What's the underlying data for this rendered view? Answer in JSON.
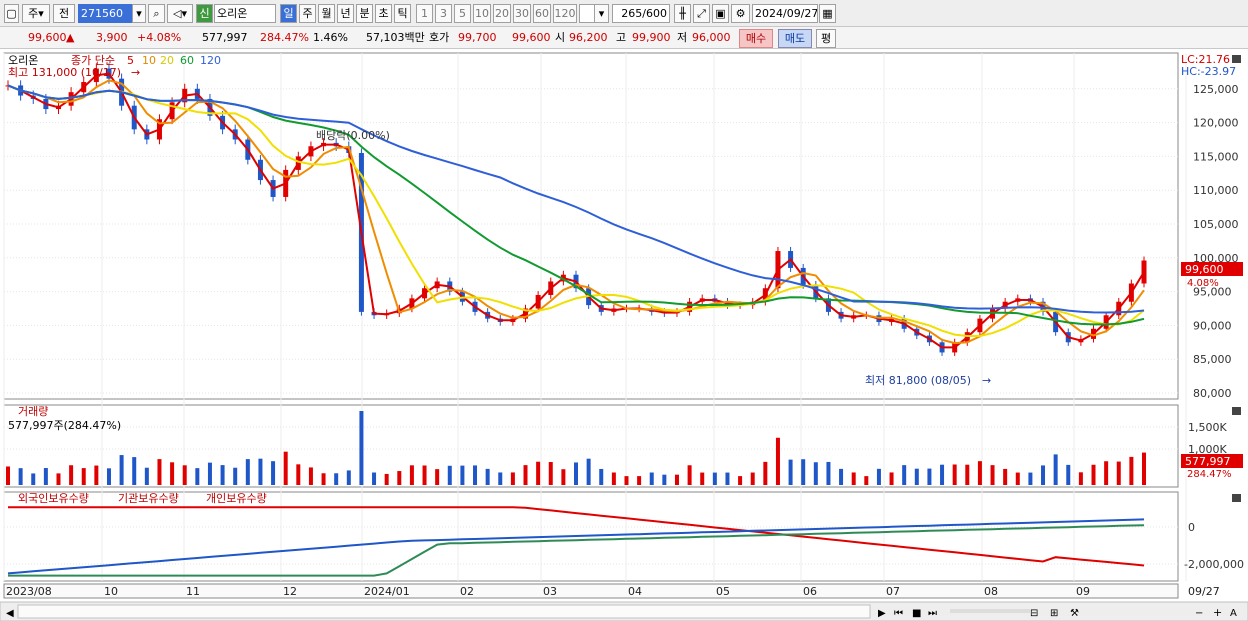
{
  "toolbar": {
    "market_label": "주",
    "prev_label": "전",
    "code": "271560",
    "badge": "신",
    "name": "오리온",
    "periods": [
      "일",
      "주",
      "월",
      "년",
      "분",
      "초",
      "틱"
    ],
    "intervals": [
      "1",
      "3",
      "5",
      "10",
      "20",
      "30",
      "60",
      "120"
    ],
    "count": "265",
    "count_max": "/600",
    "date": "2024/09/27"
  },
  "quote": {
    "price": "99,600",
    "arrow": "▲",
    "change": "3,900",
    "rate": "+4.08%",
    "volume": "577,997",
    "vol_ratio": "284.47%",
    "turnover": "1.46%",
    "amount": "57,103백만",
    "hoga_label": "호가",
    "ask": "99,700",
    "bid": "99,600",
    "open_label": "시",
    "open": "96,200",
    "high_label": "고",
    "high": "99,900",
    "low_label": "저",
    "low": "96,000",
    "buy_label": "매수",
    "sell_label": "매도",
    "eval_label": "평"
  },
  "price_pane": {
    "legend_name": "오리온",
    "legend_type": "종가 단순",
    "ma_labels": [
      "5",
      "10",
      "20",
      "60",
      "120"
    ],
    "lc": "LC:21.76",
    "hc": "HC:-23.97",
    "high_note": "최고 131,000 (10/17)",
    "low_note": "최저 81,800 (08/05)",
    "dividend_note": "배당락(0.00%)",
    "last_price": "99,600",
    "last_rate": "4.08%"
  },
  "volume_pane": {
    "title": "거래량",
    "detail": "577,997주(284.47%)",
    "last_volume": "577,997",
    "last_rate": "284.47%"
  },
  "holding_pane": {
    "legends": [
      "외국인보유수량",
      "기관보유수량",
      "개인보유수량"
    ]
  },
  "colors": {
    "ma5": "#e00000",
    "ma10": "#f08c00",
    "ma20": "#f0e000",
    "ma60": "#119a2f",
    "ma120": "#2f5fd8",
    "up": "#e00000",
    "down": "#1f56c8",
    "foreign": "#e00000",
    "institution": "#1f56c8",
    "individual": "#2e8b57"
  },
  "chart_data": [
    {
      "type": "candlestick",
      "x": [
        "2023/08",
        "10",
        "11",
        "12",
        "2024/01",
        "02",
        "03",
        "04",
        "05",
        "06",
        "07",
        "08",
        "09",
        "09/27"
      ],
      "ylim": [
        80000,
        130000
      ],
      "y_ticks": [
        "125,000",
        "120,000",
        "115,000",
        "110,000",
        "105,000",
        "100,000",
        "95,000",
        "90,000",
        "85,000",
        "80,000"
      ],
      "close": [
        125500,
        124000,
        123500,
        122000,
        122500,
        124500,
        126000,
        128000,
        126500,
        122500,
        119000,
        117500,
        120500,
        123000,
        125000,
        123500,
        121000,
        119000,
        117500,
        114500,
        111500,
        109000,
        113000,
        115000,
        116500,
        117000,
        116500,
        115500,
        92000,
        91500,
        91800,
        92500,
        94000,
        95500,
        96500,
        95000,
        93500,
        92000,
        91000,
        90500,
        91000,
        92500,
        94500,
        96500,
        97500,
        95500,
        93000,
        92000,
        92500,
        92500,
        92500,
        92000,
        91800,
        92000,
        93500,
        94000,
        93500,
        93000,
        93000,
        93500,
        95500,
        101000,
        98500,
        96000,
        94000,
        92000,
        91000,
        91500,
        91500,
        90500,
        91000,
        89500,
        88500,
        87500,
        86000,
        87500,
        89000,
        91000,
        92500,
        93500,
        94000,
        93500,
        92000,
        89000,
        87500,
        88000,
        89500,
        91500,
        93500,
        96200,
        99600
      ]
    },
    {
      "type": "bar",
      "title": "거래량",
      "y_ticks": [
        "1,500K",
        "1,000K"
      ]
    },
    {
      "type": "line",
      "series": [
        {
          "name": "외국인보유수량"
        },
        {
          "name": "기관보유수량"
        },
        {
          "name": "개인보유수량"
        }
      ],
      "y_ticks": [
        "0",
        "-2,000,000"
      ]
    }
  ]
}
